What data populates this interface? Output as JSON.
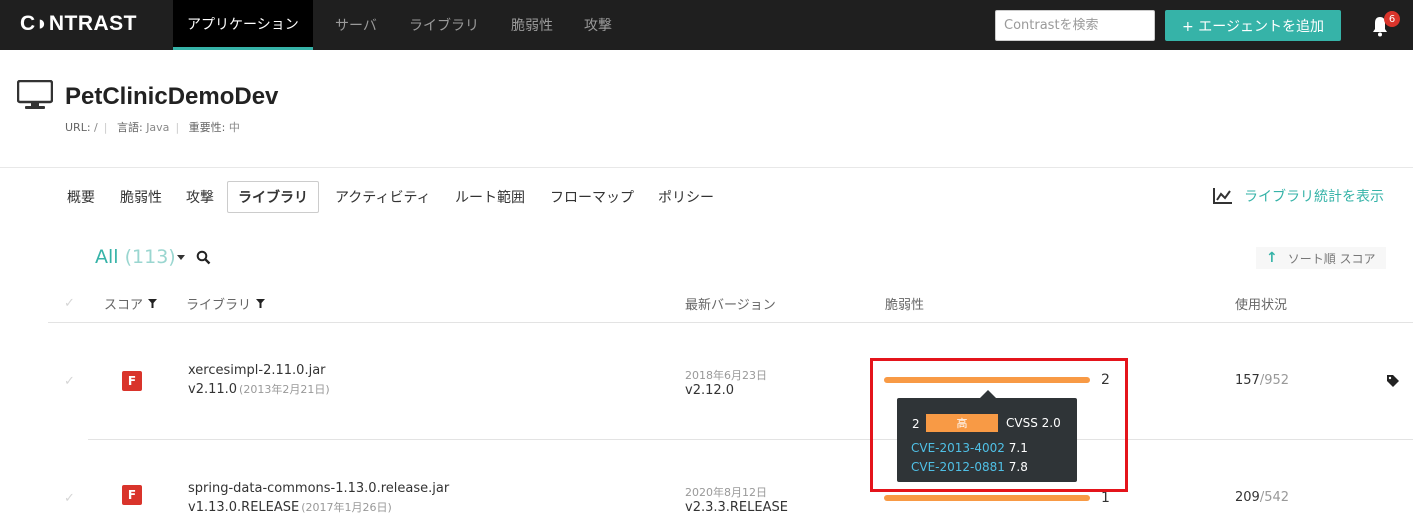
{
  "topbar": {
    "logo": "C◗NTRAST",
    "nav": [
      "アプリケーション",
      "サーバ",
      "ライブラリ",
      "脆弱性",
      "攻撃"
    ],
    "search_placeholder": "Contrastを検索",
    "add_agent_label": "+ エージェントを追加",
    "notification_count": "6"
  },
  "app": {
    "title": "PetClinicDemoDev",
    "url_label": "URL:",
    "url_value": "/",
    "lang_label": "言語:",
    "lang_value": "Java",
    "importance_label": "重要性:",
    "importance_value": "中"
  },
  "tabs": [
    "概要",
    "脆弱性",
    "攻撃",
    "ライブラリ",
    "アクティビティ",
    "ルート範囲",
    "フローマップ",
    "ポリシー"
  ],
  "stats_label": "ライブラリ統計を表示",
  "filter": {
    "all": "All",
    "count": "(113)"
  },
  "sort": {
    "label": "ソート順 スコア"
  },
  "columns": {
    "score": "スコア",
    "library": "ライブラリ",
    "latest": "最新バージョン",
    "vulns": "脆弱性",
    "usage": "使用状況"
  },
  "rows": [
    {
      "grade": "F",
      "name": "xercesimpl-2.11.0.jar",
      "version": "v2.11.0",
      "version_date": "(2013年2月21日)",
      "latest_date": "2018年6月23日",
      "latest_version": "v2.12.0",
      "vuln_count": "2",
      "usage_used": "157",
      "usage_total": "/952"
    },
    {
      "grade": "F",
      "name": "spring-data-commons-1.13.0.release.jar",
      "version": "v1.13.0.RELEASE",
      "version_date": "(2017年1月26日)",
      "latest_date": "2020年8月12日",
      "latest_version": "v2.3.3.RELEASE",
      "vuln_count": "1",
      "usage_used": "209",
      "usage_total": "/542"
    }
  ],
  "tooltip": {
    "count": "2",
    "severity": "高",
    "cvss": "CVSS 2.0",
    "cves": [
      {
        "id": "CVE-2013-4002",
        "score": "7.1"
      },
      {
        "id": "CVE-2012-0881",
        "score": "7.8"
      }
    ]
  },
  "colors": {
    "accent": "#36b3a8",
    "grade_f": "#d9342b",
    "bar": "#f89a45",
    "highlight": "#e4141b"
  }
}
